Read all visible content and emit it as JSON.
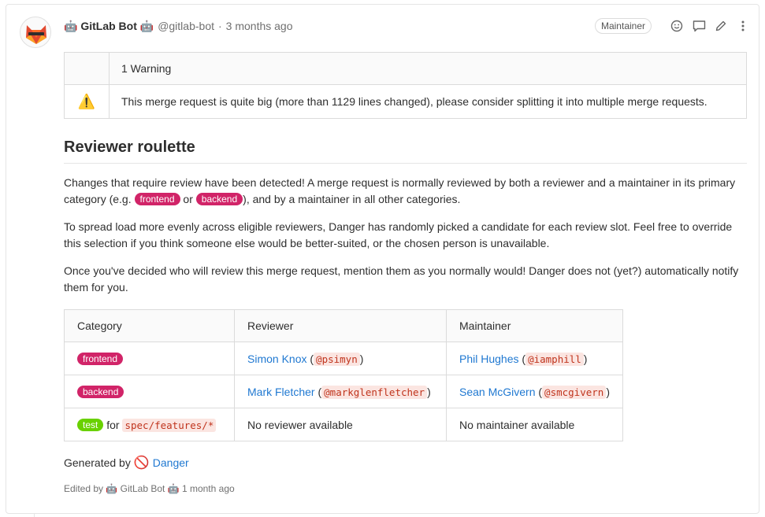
{
  "header": {
    "author": "🤖 GitLab Bot 🤖",
    "handle": "@gitlab-bot",
    "separator": "·",
    "time": "3 months ago",
    "role": "Maintainer",
    "icons": [
      "smiley-icon",
      "comment-icon",
      "pencil-icon",
      "more-vertical-icon"
    ]
  },
  "warnings": {
    "header": "1 Warning",
    "icon": "⚠️",
    "message": "This merge request is quite big (more than 1129 lines changed), please consider splitting it into multiple merge requests."
  },
  "roulette": {
    "title": "Reviewer roulette",
    "p1_a": "Changes that require review have been detected! A merge request is normally reviewed by both a reviewer and a maintainer in its primary category (e.g. ",
    "p1_label1": "frontend",
    "p1_b": " or ",
    "p1_label2": "backend",
    "p1_c": "), and by a maintainer in all other categories.",
    "p2": "To spread load more evenly across eligible reviewers, Danger has randomly picked a candidate for each review slot. Feel free to override this selection if you think someone else would be better-suited, or the chosen person is unavailable.",
    "p3": "Once you've decided who will review this merge request, mention them as you normally would! Danger does not (yet?) automatically notify them for you.",
    "table": {
      "headers": [
        "Category",
        "Reviewer",
        "Maintainer"
      ],
      "rows": [
        {
          "label": "frontend",
          "label_color": "#d12468",
          "suffix": "",
          "code": "",
          "reviewer_name": "Simon Knox",
          "reviewer_handle": "@psimyn",
          "maintainer_name": "Phil Hughes",
          "maintainer_handle": "@iamphill"
        },
        {
          "label": "backend",
          "label_color": "#d12468",
          "suffix": "",
          "code": "",
          "reviewer_name": "Mark Fletcher",
          "reviewer_handle": "@markglenfletcher",
          "maintainer_name": "Sean McGivern",
          "maintainer_handle": "@smcgivern"
        },
        {
          "label": "test",
          "label_color": "#69d100",
          "suffix": "for",
          "code": "spec/features/*",
          "reviewer_text": "No reviewer available",
          "maintainer_text": "No maintainer available"
        }
      ]
    }
  },
  "footer": {
    "generated_by": "Generated by",
    "danger_icon": "🚫",
    "danger_link": "Danger",
    "edited": "Edited by 🤖 GitLab Bot 🤖 1 month ago"
  },
  "colors": {
    "link": "#1f78d1",
    "label_pink": "#d12468",
    "label_green": "#69d100"
  }
}
